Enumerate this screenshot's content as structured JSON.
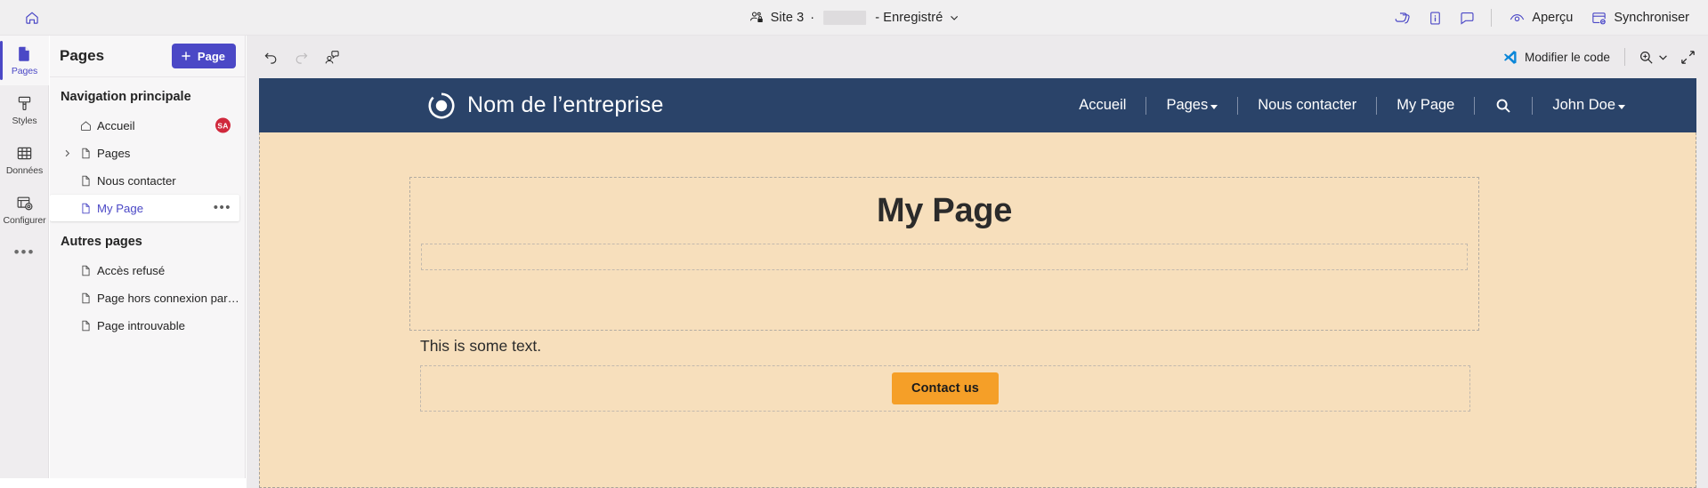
{
  "appbar": {
    "home_icon": "home-icon",
    "site_name": "Site 3",
    "separator": "·",
    "saved_status": "- Enregistré",
    "chevron": "⌄",
    "icons": [
      {
        "name": "copilot-icon"
      },
      {
        "name": "info-icon"
      },
      {
        "name": "feedback-comment-icon"
      }
    ],
    "preview_label": "Aperçu",
    "preview_icon": "eye-preview-icon",
    "sync_label": "Synchroniser",
    "sync_icon": "sync-site-icon"
  },
  "rail": {
    "items": [
      {
        "label": "Pages",
        "icon": "page-file-icon",
        "active": true
      },
      {
        "label": "Styles",
        "icon": "paint-brush-icon",
        "active": false
      },
      {
        "label": "Données",
        "icon": "table-grid-icon",
        "active": false
      },
      {
        "label": "Configurer",
        "icon": "setup-gear-icon",
        "active": false
      }
    ],
    "more_label": "•••"
  },
  "panel": {
    "title": "Pages",
    "add_button_label": "Page",
    "add_button_icon": "plus-icon",
    "groups": [
      {
        "title": "Navigation principale",
        "items": [
          {
            "label": "Accueil",
            "icon": "home-page-icon",
            "chevron": false,
            "selected": false,
            "badge": "SA"
          },
          {
            "label": "Pages",
            "icon": "page-file-icon",
            "chevron": true,
            "selected": false,
            "badge": ""
          },
          {
            "label": "Nous contacter",
            "icon": "page-file-icon",
            "chevron": false,
            "selected": false,
            "badge": ""
          },
          {
            "label": "My Page",
            "icon": "page-file-icon",
            "chevron": false,
            "selected": true,
            "badge": "",
            "more": "•••"
          }
        ]
      },
      {
        "title": "Autres pages",
        "items": [
          {
            "label": "Accès refusé",
            "icon": "page-file-icon",
            "chevron": false,
            "selected": false,
            "badge": ""
          },
          {
            "label": "Page hors connexion par défaut",
            "icon": "page-file-icon",
            "chevron": false,
            "selected": false,
            "badge": ""
          },
          {
            "label": "Page introuvable",
            "icon": "page-file-icon",
            "chevron": false,
            "selected": false,
            "badge": ""
          }
        ]
      }
    ]
  },
  "canvas_toolbar": {
    "undo_icon": "undo-arrow-icon",
    "redo_icon": "redo-arrow-icon",
    "coauthor_icon": "co-authoring-person-icon",
    "edit_code_label": "Modifier le code",
    "edit_code_icon": "visual-studio-code-icon",
    "zoom_icon": "zoom-in-magnifier-icon",
    "zoom_chevron": "⌄",
    "fullscreen_icon": "expand-diagonal-icon"
  },
  "site_preview": {
    "brand_name": "Nom de l’entreprise",
    "brand_logo_icon": "target-ring-logo-icon",
    "nav": [
      {
        "label": "Accueil",
        "caret": false
      },
      {
        "label": "Pages",
        "caret": true
      },
      {
        "label": "Nous contacter",
        "caret": false
      },
      {
        "label": "My Page",
        "caret": false
      }
    ],
    "search_icon": "search-magnifier-icon",
    "user_label": "John Doe",
    "user_caret": true,
    "heading": "My Page",
    "body_text": "This is some text.",
    "cta_label": "Contact us"
  },
  "colors": {
    "accent_purple": "#4b48c6",
    "site_header_navy": "#2a4369",
    "page_background_peach": "#f7dfbc",
    "cta_orange": "#f59f28",
    "badge_red": "#d0283c",
    "vscode_blue": "#0b86d8"
  }
}
